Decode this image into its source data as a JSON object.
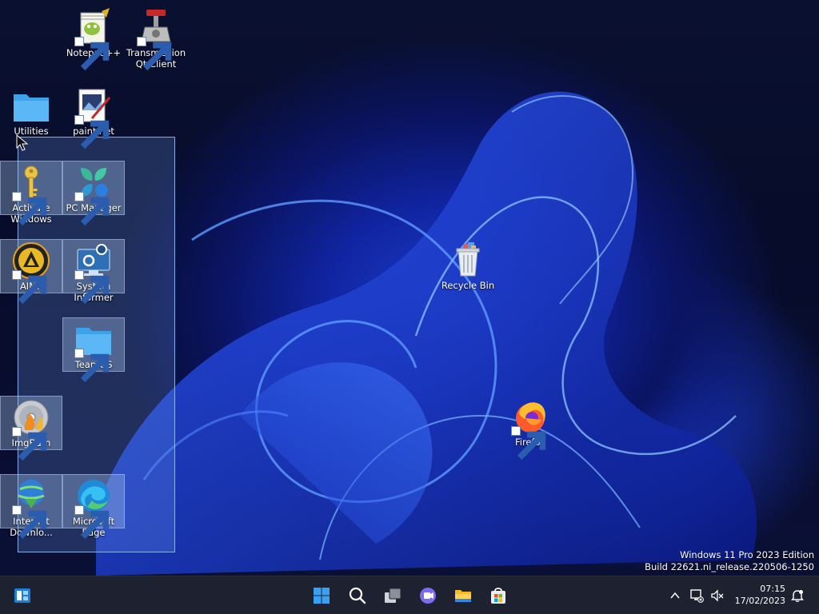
{
  "desktop": {
    "icons": [
      {
        "id": "notepadpp",
        "label": "Notepad++",
        "icon": "notepad-plus-plus-icon",
        "shortcut": true,
        "selected": false
      },
      {
        "id": "transmission",
        "label": "Transmission Qt Client",
        "icon": "transmission-icon",
        "shortcut": true,
        "selected": false
      },
      {
        "id": "utilities",
        "label": "Utilities",
        "icon": "folder-icon",
        "shortcut": false,
        "selected": false
      },
      {
        "id": "paintnet",
        "label": "paint.net",
        "icon": "paint-net-icon",
        "shortcut": true,
        "selected": false
      },
      {
        "id": "activate",
        "label": "Activate Windows",
        "icon": "key-icon",
        "shortcut": true,
        "selected": true
      },
      {
        "id": "pcmanager",
        "label": "PC Manager",
        "icon": "pc-manager-icon",
        "shortcut": true,
        "selected": true
      },
      {
        "id": "aimp",
        "label": "AIMP",
        "icon": "aimp-icon",
        "shortcut": true,
        "selected": true
      },
      {
        "id": "sysinformer",
        "label": "System Informer",
        "icon": "system-informer-icon",
        "shortcut": true,
        "selected": true
      },
      {
        "id": "teamos",
        "label": "TeamOS",
        "icon": "folder-icon",
        "shortcut": true,
        "selected": true
      },
      {
        "id": "imgburn",
        "label": "ImgBurn",
        "icon": "imgburn-disc-icon",
        "shortcut": true,
        "selected": true
      },
      {
        "id": "idm",
        "label": "Internet Downlo...",
        "icon": "internet-download-manager-icon",
        "shortcut": true,
        "selected": true
      },
      {
        "id": "edge",
        "label": "Microsoft Edge",
        "icon": "edge-icon",
        "shortcut": true,
        "selected": true
      },
      {
        "id": "recycle",
        "label": "Recycle Bin",
        "icon": "recycle-bin-icon",
        "shortcut": false,
        "selected": false
      },
      {
        "id": "firefox",
        "label": "Firefox",
        "icon": "firefox-icon",
        "shortcut": true,
        "selected": false
      }
    ]
  },
  "watermark": {
    "line1": "Windows 11 Pro 2023 Edition",
    "line2": "Build 22621.ni_release.220506-1250"
  },
  "taskbar": {
    "left": {
      "icon": "widgets-icon"
    },
    "apps": [
      {
        "name": "start",
        "icon": "windows-start-icon"
      },
      {
        "name": "search",
        "icon": "search-icon"
      },
      {
        "name": "task-view",
        "icon": "task-view-icon"
      },
      {
        "name": "chat",
        "icon": "teams-chat-icon"
      },
      {
        "name": "file-explorer",
        "icon": "file-explorer-icon"
      },
      {
        "name": "store",
        "icon": "microsoft-store-icon"
      }
    ],
    "tray": {
      "icons": [
        "chevron-up-icon",
        "network-icon",
        "volume-muted-icon",
        "notification-icon"
      ],
      "time": "07:15",
      "date": "17/02/2023"
    }
  },
  "colors": {
    "taskbar_bg": "#1e2230",
    "selection_fill": "#78aaff",
    "wallpaper_blue": "#1c3bc9"
  }
}
